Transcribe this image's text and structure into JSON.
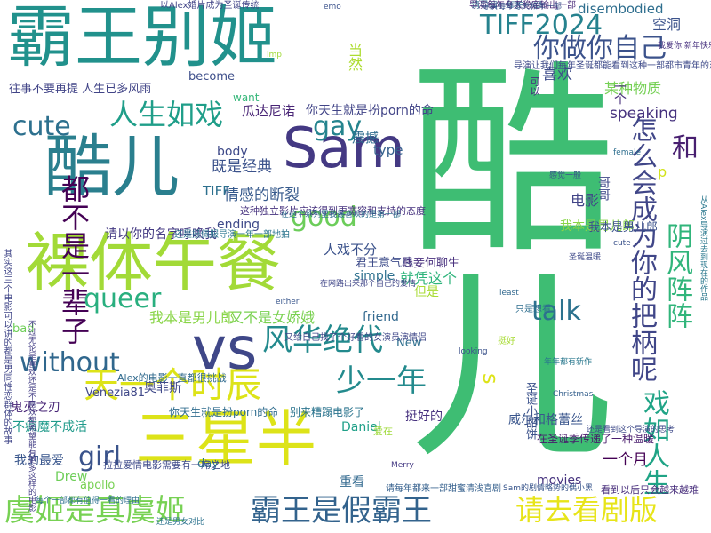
{
  "word_cloud": {
    "background": "#ffffff",
    "words": [
      {
        "text": "酷儿",
        "color": "#2a7f8e"
      },
      {
        "text": "霸王别姬",
        "color": "#21918c"
      },
      {
        "text": "裸体午餐",
        "color": "#a2da37"
      },
      {
        "text": "Sam",
        "color": "#443983"
      },
      {
        "text": "vs",
        "color": "#3f4788"
      },
      {
        "text": "三星半",
        "color": "#dde318"
      },
      {
        "text": "虞姬是真虞姬",
        "color": "#77d153"
      },
      {
        "text": "霸王是假霸王",
        "color": "#33638d"
      },
      {
        "text": "请去看剧版",
        "color": "#e7e419"
      },
      {
        "text": "怎么会成为你的把柄呢",
        "color": "#404688"
      },
      {
        "text": "戏如人生",
        "color": "#20a486"
      },
      {
        "text": "阴风阵阵",
        "color": "#31b57b"
      },
      {
        "text": "风华绝代",
        "color": "#238a8d"
      },
      {
        "text": "人生如戏",
        "color": "#1f9e89"
      },
      {
        "text": "你做你自己",
        "color": "#3b528b"
      },
      {
        "text": "TIFF2024",
        "color": "#26828e"
      },
      {
        "text": "都不是一辈子",
        "color": "#440154"
      },
      {
        "text": "cute",
        "color": "#2d708e"
      },
      {
        "text": "gay",
        "color": "#25848e"
      },
      {
        "text": "queer",
        "color": "#29af7f"
      },
      {
        "text": "talk",
        "color": "#2c728e"
      },
      {
        "text": "good",
        "color": "#6ccd5a"
      },
      {
        "text": "without",
        "color": "#30678d"
      },
      {
        "text": "girl",
        "color": "#3a538b"
      },
      {
        "text": "天一个时辰",
        "color": "#dde318"
      },
      {
        "text": "少一年",
        "color": "#238a8d"
      },
      {
        "text": "和",
        "color": "#481f70"
      },
      {
        "text": "s",
        "color": "#2c728e"
      },
      {
        "text": "一个月",
        "color": "#440154"
      },
      {
        "text": "瓜达尼诺",
        "color": "#482475"
      },
      {
        "text": "你天生就是扮porn的命",
        "color": "#414487"
      },
      {
        "text": "当然",
        "color": "#addc30"
      },
      {
        "text": "喜欢",
        "color": "#3e4c8a"
      },
      {
        "text": "空洞",
        "color": "#3b528b"
      },
      {
        "text": "某种物质",
        "color": "#75d054"
      },
      {
        "text": "speaking",
        "color": "#46327e"
      },
      {
        "text": "disembodied",
        "color": "#2e6e8e"
      },
      {
        "text": "震撼",
        "color": "#2f6c8e"
      },
      {
        "text": "type",
        "color": "#35608d"
      },
      {
        "text": "既是经典",
        "color": "#3b528b"
      },
      {
        "text": "情感的断裂",
        "color": "#375a8c"
      },
      {
        "text": "body",
        "color": "#3e4a89"
      },
      {
        "text": "TIFF",
        "color": "#2d708e"
      },
      {
        "text": "电影",
        "color": "#414487"
      },
      {
        "text": "我本是男儿郎",
        "color": "#89d548"
      },
      {
        "text": "又不是女娇娥",
        "color": "#7ad151"
      },
      {
        "text": "人戏不分",
        "color": "#3b528b"
      },
      {
        "text": "君王意气尽",
        "color": "#3e4c8a"
      },
      {
        "text": "贱妾何聊生",
        "color": "#472f7d"
      },
      {
        "text": "请以你的名字呼唤我",
        "color": "#443a83"
      },
      {
        "text": "就凭这个",
        "color": "#2fb47c"
      },
      {
        "text": "但是",
        "color": "#a8db34"
      },
      {
        "text": "simple",
        "color": "#2d708e"
      },
      {
        "text": "ending",
        "color": "#3e4989"
      },
      {
        "text": "friend",
        "color": "#31688e"
      },
      {
        "text": "Venezia81",
        "color": "#3f4788"
      },
      {
        "text": "鬼灭之刃",
        "color": "#482677"
      },
      {
        "text": "奥菲斯",
        "color": "#3f4889"
      },
      {
        "text": "不疯魔不成活",
        "color": "#1f9a8a"
      },
      {
        "text": "Daniel",
        "color": "#1fa088"
      },
      {
        "text": "挺好的",
        "color": "#46307e"
      },
      {
        "text": "威尔和格蕾丝",
        "color": "#39558c"
      },
      {
        "text": "我的最爱",
        "color": "#39568c"
      },
      {
        "text": "day",
        "color": "#2a788e"
      },
      {
        "text": "Drew",
        "color": "#6ece58"
      },
      {
        "text": "apollo",
        "color": "#77d153"
      },
      {
        "text": "重看",
        "color": "#31688e"
      },
      {
        "text": "movies",
        "color": "#46337f"
      },
      {
        "text": "New",
        "color": "#2e6f8e"
      },
      {
        "text": "bad",
        "color": "#6ece58"
      },
      {
        "text": "往事不要再提 人生已多风雨",
        "color": "#414487"
      },
      {
        "text": "我本是男儿郎",
        "color": "#3b528b"
      },
      {
        "text": "become",
        "color": "#3d4e8a"
      },
      {
        "text": "want",
        "color": "#35b779"
      },
      {
        "text": "你天生就是扮porn的命",
        "color": "#2f6c8e"
      },
      {
        "text": "别来糟蹋电影了",
        "color": "#2b748e"
      },
      {
        "text": "拉拉爱情电影需要有一席之地",
        "color": "#3e4a89"
      },
      {
        "text": "在圣诞季传递了一种温暖",
        "color": "#481a6c"
      },
      {
        "text": "Alex的电影一直都很挑战",
        "color": "#306a8e"
      },
      {
        "text": "还是挺佩服导演一年一部地拍",
        "color": "#2b758e"
      },
      {
        "text": "这种独立影片应该得到更宽容和支持的态度",
        "color": "#46327e"
      },
      {
        "text": "请导演一年拍一部",
        "color": "#31688e"
      },
      {
        "text": "哥哥",
        "color": "#3f4889"
      },
      {
        "text": "圣诞小甜饼",
        "color": "#3b528b"
      },
      {
        "text": "导演每年冬天稳定输出一部",
        "color": "#482878"
      },
      {
        "text": "导演让我们每年圣诞都能看到这种一部都市青年的恋爱喜剧电影",
        "color": "#3e4a89"
      },
      {
        "text": "其实这三个电影可以讲的都是男同性恋群体的故事",
        "color": "#404688"
      },
      {
        "text": "不过无论是喜欢还是不喜欢都希望能有更多这样的电影",
        "color": "#433e85"
      },
      {
        "text": "在这个系列里我最喜欢的是第一部",
        "color": "#2d708e"
      },
      {
        "text": "导演每年冬天和年一部",
        "color": "#3b528b"
      },
      {
        "text": "又给自己找了个好看的女演员演情侣",
        "color": "#3f4788"
      },
      {
        "text": "每个一部都有值得一看的理由",
        "color": "#2d708e"
      },
      {
        "text": "请每年都来一部甜蜜清浅喜剧",
        "color": "#35608d"
      },
      {
        "text": "Sam的剧情略势的偶小黑",
        "color": "#39568c"
      },
      {
        "text": "从Alex导演过去到现在的作品",
        "color": "#2a788e"
      },
      {
        "text": "还是看到这个导演的思考",
        "color": "#3e4a89"
      },
      {
        "text": "在网路出来那个自己的爱情",
        "color": "#404688"
      },
      {
        "text": "Christmas",
        "color": "#35608d"
      },
      {
        "text": "Merry",
        "color": "#443983"
      },
      {
        "text": "爱在",
        "color": "#9fda3a"
      },
      {
        "text": "p",
        "color": "#d2e21b"
      },
      {
        "text": "一个",
        "color": "#472c7a"
      },
      {
        "text": "可以",
        "color": "#46317e"
      },
      {
        "text": "只是想看",
        "color": "#2e6e8e"
      },
      {
        "text": "挺好",
        "color": "#a8db34"
      },
      {
        "text": "imp",
        "color": "#a0da39"
      },
      {
        "text": "cute",
        "color": "#3b528b"
      },
      {
        "text": "看到以后只会越来越难",
        "color": "#472d7b"
      },
      {
        "text": "以Alex婚片成为圣诞传统",
        "color": "#414487"
      },
      {
        "text": "还是男女对比",
        "color": "#2c728e"
      },
      {
        "text": "emo",
        "color": "#3b528b"
      },
      {
        "text": "我爱你 新年快乐",
        "color": "#46307e"
      },
      {
        "text": "感觉一般",
        "color": "#3a548c"
      },
      {
        "text": "年年都有新作",
        "color": "#2a788e"
      },
      {
        "text": "圣诞温暖",
        "color": "#3e4989"
      },
      {
        "text": "female",
        "color": "#2e6e8e"
      },
      {
        "text": "looking",
        "color": "#3b528b"
      },
      {
        "text": "either",
        "color": "#39568c"
      },
      {
        "text": "least",
        "color": "#31688e"
      }
    ]
  }
}
